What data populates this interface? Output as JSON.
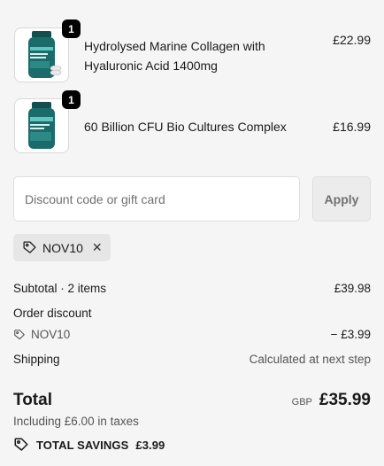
{
  "items": [
    {
      "title": "Hydrolysed Marine Collagen with Hyaluronic Acid 1400mg",
      "quantity": "1",
      "price": "£22.99",
      "product_image": "teal-supplement-jar-with-capsules"
    },
    {
      "title": "60 Billion CFU Bio Cultures Complex",
      "quantity": "1",
      "price": "£16.99",
      "product_image": "teal-supplement-jar"
    }
  ],
  "discount": {
    "placeholder": "Discount code or gift card",
    "apply_label": "Apply",
    "applied_code": "NOV10"
  },
  "summary": {
    "subtotal_label": "Subtotal · 2 items",
    "subtotal_value": "£39.98",
    "order_discount_label": "Order discount",
    "discount_code": "NOV10",
    "discount_value": "− £3.99",
    "shipping_label": "Shipping",
    "shipping_value": "Calculated at next step",
    "total_label": "Total",
    "currency": "GBP",
    "total_value": "£35.99",
    "taxes_note": "Including £6.00 in taxes",
    "savings_label": "TOTAL SAVINGS",
    "savings_value": "£3.99"
  },
  "icons": {
    "tag": "tag-icon",
    "close": "close-icon"
  },
  "colors": {
    "background": "#f5f5f5",
    "jar_teal": "#1c6b6b",
    "badge": "#000000",
    "chip": "#e6e6e6"
  }
}
